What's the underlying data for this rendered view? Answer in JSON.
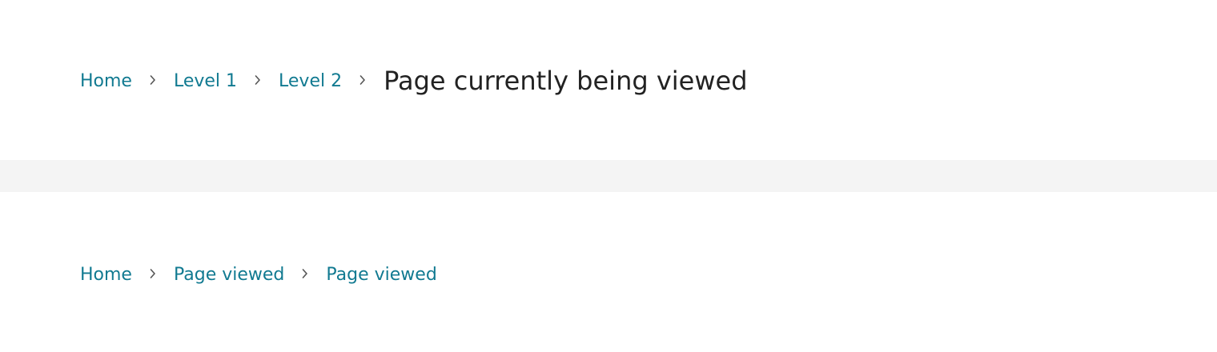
{
  "breadcrumb_full": {
    "home": "Home",
    "level1": "Level 1",
    "level2": "Level 2",
    "current": "Page currently being viewed"
  },
  "breadcrumb_short": {
    "home": "Home",
    "item1": "Page viewed",
    "item2": "Page viewed"
  },
  "icons": {
    "separator": "chevron-right-icon"
  },
  "colors": {
    "link": "#117a91",
    "current_text": "#222222",
    "separator": "#555555",
    "band": "#f4f4f4"
  }
}
